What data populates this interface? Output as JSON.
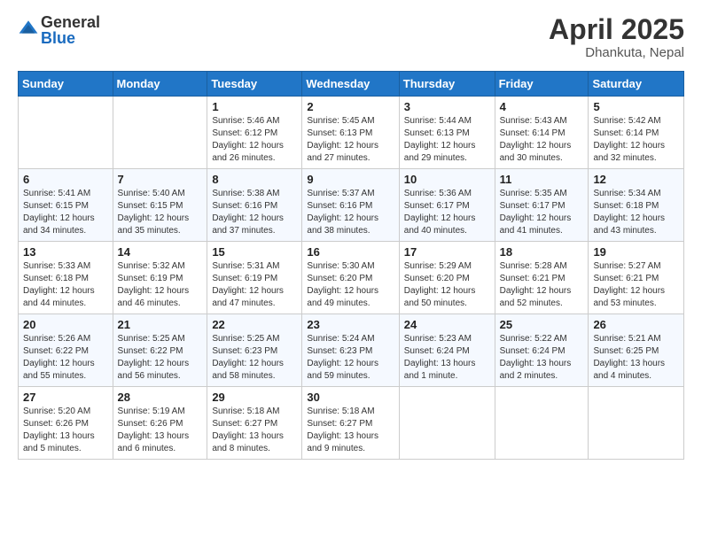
{
  "header": {
    "logo_general": "General",
    "logo_blue": "Blue",
    "month_title": "April 2025",
    "location": "Dhankuta, Nepal"
  },
  "weekdays": [
    "Sunday",
    "Monday",
    "Tuesday",
    "Wednesday",
    "Thursday",
    "Friday",
    "Saturday"
  ],
  "weeks": [
    [
      {
        "day": "",
        "detail": ""
      },
      {
        "day": "",
        "detail": ""
      },
      {
        "day": "1",
        "detail": "Sunrise: 5:46 AM\nSunset: 6:12 PM\nDaylight: 12 hours and 26 minutes."
      },
      {
        "day": "2",
        "detail": "Sunrise: 5:45 AM\nSunset: 6:13 PM\nDaylight: 12 hours and 27 minutes."
      },
      {
        "day": "3",
        "detail": "Sunrise: 5:44 AM\nSunset: 6:13 PM\nDaylight: 12 hours and 29 minutes."
      },
      {
        "day": "4",
        "detail": "Sunrise: 5:43 AM\nSunset: 6:14 PM\nDaylight: 12 hours and 30 minutes."
      },
      {
        "day": "5",
        "detail": "Sunrise: 5:42 AM\nSunset: 6:14 PM\nDaylight: 12 hours and 32 minutes."
      }
    ],
    [
      {
        "day": "6",
        "detail": "Sunrise: 5:41 AM\nSunset: 6:15 PM\nDaylight: 12 hours and 34 minutes."
      },
      {
        "day": "7",
        "detail": "Sunrise: 5:40 AM\nSunset: 6:15 PM\nDaylight: 12 hours and 35 minutes."
      },
      {
        "day": "8",
        "detail": "Sunrise: 5:38 AM\nSunset: 6:16 PM\nDaylight: 12 hours and 37 minutes."
      },
      {
        "day": "9",
        "detail": "Sunrise: 5:37 AM\nSunset: 6:16 PM\nDaylight: 12 hours and 38 minutes."
      },
      {
        "day": "10",
        "detail": "Sunrise: 5:36 AM\nSunset: 6:17 PM\nDaylight: 12 hours and 40 minutes."
      },
      {
        "day": "11",
        "detail": "Sunrise: 5:35 AM\nSunset: 6:17 PM\nDaylight: 12 hours and 41 minutes."
      },
      {
        "day": "12",
        "detail": "Sunrise: 5:34 AM\nSunset: 6:18 PM\nDaylight: 12 hours and 43 minutes."
      }
    ],
    [
      {
        "day": "13",
        "detail": "Sunrise: 5:33 AM\nSunset: 6:18 PM\nDaylight: 12 hours and 44 minutes."
      },
      {
        "day": "14",
        "detail": "Sunrise: 5:32 AM\nSunset: 6:19 PM\nDaylight: 12 hours and 46 minutes."
      },
      {
        "day": "15",
        "detail": "Sunrise: 5:31 AM\nSunset: 6:19 PM\nDaylight: 12 hours and 47 minutes."
      },
      {
        "day": "16",
        "detail": "Sunrise: 5:30 AM\nSunset: 6:20 PM\nDaylight: 12 hours and 49 minutes."
      },
      {
        "day": "17",
        "detail": "Sunrise: 5:29 AM\nSunset: 6:20 PM\nDaylight: 12 hours and 50 minutes."
      },
      {
        "day": "18",
        "detail": "Sunrise: 5:28 AM\nSunset: 6:21 PM\nDaylight: 12 hours and 52 minutes."
      },
      {
        "day": "19",
        "detail": "Sunrise: 5:27 AM\nSunset: 6:21 PM\nDaylight: 12 hours and 53 minutes."
      }
    ],
    [
      {
        "day": "20",
        "detail": "Sunrise: 5:26 AM\nSunset: 6:22 PM\nDaylight: 12 hours and 55 minutes."
      },
      {
        "day": "21",
        "detail": "Sunrise: 5:25 AM\nSunset: 6:22 PM\nDaylight: 12 hours and 56 minutes."
      },
      {
        "day": "22",
        "detail": "Sunrise: 5:25 AM\nSunset: 6:23 PM\nDaylight: 12 hours and 58 minutes."
      },
      {
        "day": "23",
        "detail": "Sunrise: 5:24 AM\nSunset: 6:23 PM\nDaylight: 12 hours and 59 minutes."
      },
      {
        "day": "24",
        "detail": "Sunrise: 5:23 AM\nSunset: 6:24 PM\nDaylight: 13 hours and 1 minute."
      },
      {
        "day": "25",
        "detail": "Sunrise: 5:22 AM\nSunset: 6:24 PM\nDaylight: 13 hours and 2 minutes."
      },
      {
        "day": "26",
        "detail": "Sunrise: 5:21 AM\nSunset: 6:25 PM\nDaylight: 13 hours and 4 minutes."
      }
    ],
    [
      {
        "day": "27",
        "detail": "Sunrise: 5:20 AM\nSunset: 6:26 PM\nDaylight: 13 hours and 5 minutes."
      },
      {
        "day": "28",
        "detail": "Sunrise: 5:19 AM\nSunset: 6:26 PM\nDaylight: 13 hours and 6 minutes."
      },
      {
        "day": "29",
        "detail": "Sunrise: 5:18 AM\nSunset: 6:27 PM\nDaylight: 13 hours and 8 minutes."
      },
      {
        "day": "30",
        "detail": "Sunrise: 5:18 AM\nSunset: 6:27 PM\nDaylight: 13 hours and 9 minutes."
      },
      {
        "day": "",
        "detail": ""
      },
      {
        "day": "",
        "detail": ""
      },
      {
        "day": "",
        "detail": ""
      }
    ]
  ]
}
